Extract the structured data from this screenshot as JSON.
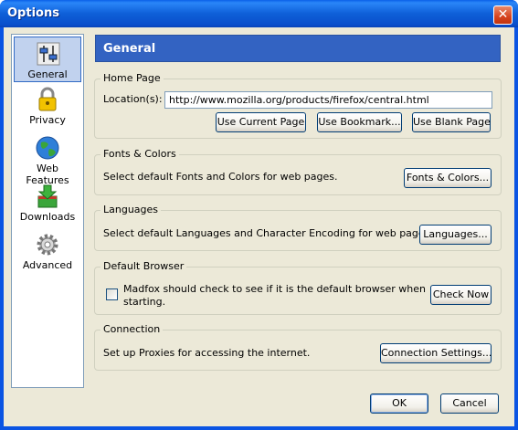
{
  "window": {
    "title": "Options",
    "close_glyph": "✕"
  },
  "sidebar": {
    "items": [
      {
        "label": "General",
        "icon": "general-sliders-icon",
        "selected": true
      },
      {
        "label": "Privacy",
        "icon": "padlock-icon",
        "selected": false
      },
      {
        "label": "Web Features",
        "icon": "globe-icon",
        "selected": false
      },
      {
        "label": "Downloads",
        "icon": "download-box-icon",
        "selected": false
      },
      {
        "label": "Advanced",
        "icon": "gear-icon",
        "selected": false
      }
    ]
  },
  "panel": {
    "title": "General"
  },
  "home_page": {
    "title": "Home Page",
    "location_label": "Location(s):",
    "location_value": "http://www.mozilla.org/products/firefox/central.html",
    "use_current_label": "Use Current Page",
    "use_bookmark_label": "Use Bookmark...",
    "use_blank_label": "Use Blank Page"
  },
  "fonts_colors": {
    "title": "Fonts & Colors",
    "description": "Select default Fonts and Colors for web pages.",
    "button_label": "Fonts & Colors..."
  },
  "languages": {
    "title": "Languages",
    "description": "Select default Languages and Character Encoding for web pages.",
    "button_label": "Languages..."
  },
  "default_browser": {
    "title": "Default Browser",
    "checkbox_line1": "Madfox should check to see if it is the default browser when",
    "checkbox_line2": "starting.",
    "checked": false,
    "button_label": "Check Now"
  },
  "connection": {
    "title": "Connection",
    "description": "Set up Proxies for accessing the internet.",
    "button_label": "Connection Settings..."
  },
  "footer": {
    "ok_label": "OK",
    "cancel_label": "Cancel"
  },
  "colors": {
    "titlebar": "#0a5fe8",
    "header": "#3363c2",
    "selected_item": "#c1d2ee",
    "dialog_bg": "#ece9d8"
  }
}
